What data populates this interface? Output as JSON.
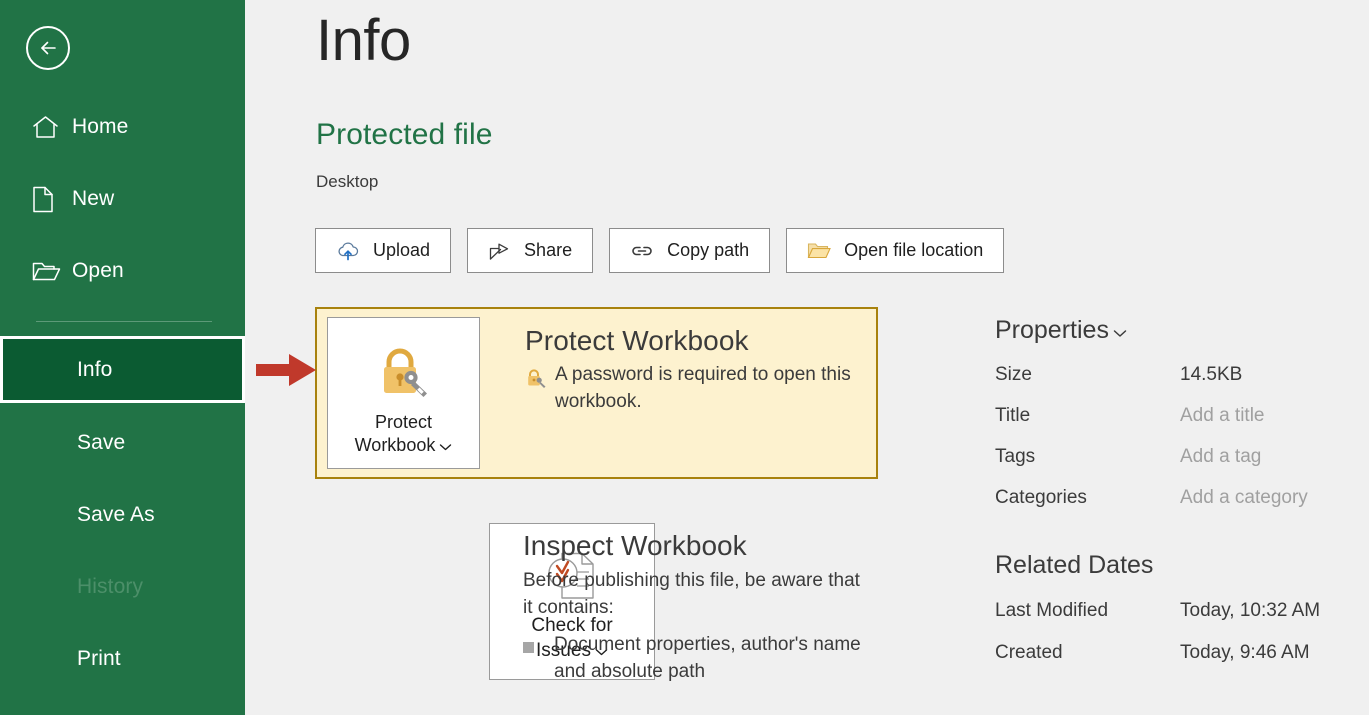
{
  "sidebar": {
    "back_icon": "back-arrow-icon",
    "items": [
      {
        "label": "Home",
        "icon": "home-icon",
        "state": "normal"
      },
      {
        "label": "New",
        "icon": "new-document-icon",
        "state": "normal"
      },
      {
        "label": "Open",
        "icon": "open-folder-icon",
        "state": "normal"
      },
      {
        "label": "Info",
        "icon": null,
        "state": "selected"
      },
      {
        "label": "Save",
        "icon": null,
        "state": "normal"
      },
      {
        "label": "Save As",
        "icon": null,
        "state": "normal"
      },
      {
        "label": "History",
        "icon": null,
        "state": "disabled"
      },
      {
        "label": "Print",
        "icon": null,
        "state": "normal"
      }
    ],
    "background_color": "#217346",
    "selected_color": "#0b5b32"
  },
  "header": {
    "title": "Info",
    "file_name": "Protected file",
    "file_location": "Desktop",
    "file_name_color": "#217346"
  },
  "toolbar": {
    "buttons": [
      {
        "label": "Upload",
        "icon": "cloud-upload-icon"
      },
      {
        "label": "Share",
        "icon": "share-icon"
      },
      {
        "label": "Copy path",
        "icon": "link-icon"
      },
      {
        "label": "Open file location",
        "icon": "folder-icon"
      }
    ]
  },
  "protect_section": {
    "tile_label_line1": "Protect",
    "tile_label_line2": "Workbook",
    "tile_chevron": "chevron-down-icon",
    "tile_icon": "lock-key-icon",
    "heading": "Protect Workbook",
    "status_icon": "lock-key-small-icon",
    "description": "A password is required to open this workbook.",
    "highlight_background": "#fdf2cf",
    "highlight_border": "#a8820d"
  },
  "inspect_section": {
    "tile_label_line1": "Check for",
    "tile_label_line2": "Issues",
    "tile_chevron": "chevron-down-icon",
    "tile_icon": "document-check-icon",
    "heading": "Inspect Workbook",
    "description": "Before publishing this file, be aware that it contains:",
    "bullets": [
      "Document properties, author's name and absolute path"
    ]
  },
  "properties": {
    "heading": "Properties",
    "heading_chevron": "chevron-down-icon",
    "rows": [
      {
        "label": "Size",
        "value": "14.5KB",
        "is_placeholder": false
      },
      {
        "label": "Title",
        "value": "Add a title",
        "is_placeholder": true
      },
      {
        "label": "Tags",
        "value": "Add a tag",
        "is_placeholder": true
      },
      {
        "label": "Categories",
        "value": "Add a category",
        "is_placeholder": true
      }
    ]
  },
  "related_dates": {
    "heading": "Related Dates",
    "rows": [
      {
        "label": "Last Modified",
        "value": "Today, 10:32 AM"
      },
      {
        "label": "Created",
        "value": "Today, 9:46 AM"
      }
    ]
  },
  "annotation": {
    "arrow_color": "#c0392b",
    "arrow_name": "red-pointer-arrow"
  }
}
